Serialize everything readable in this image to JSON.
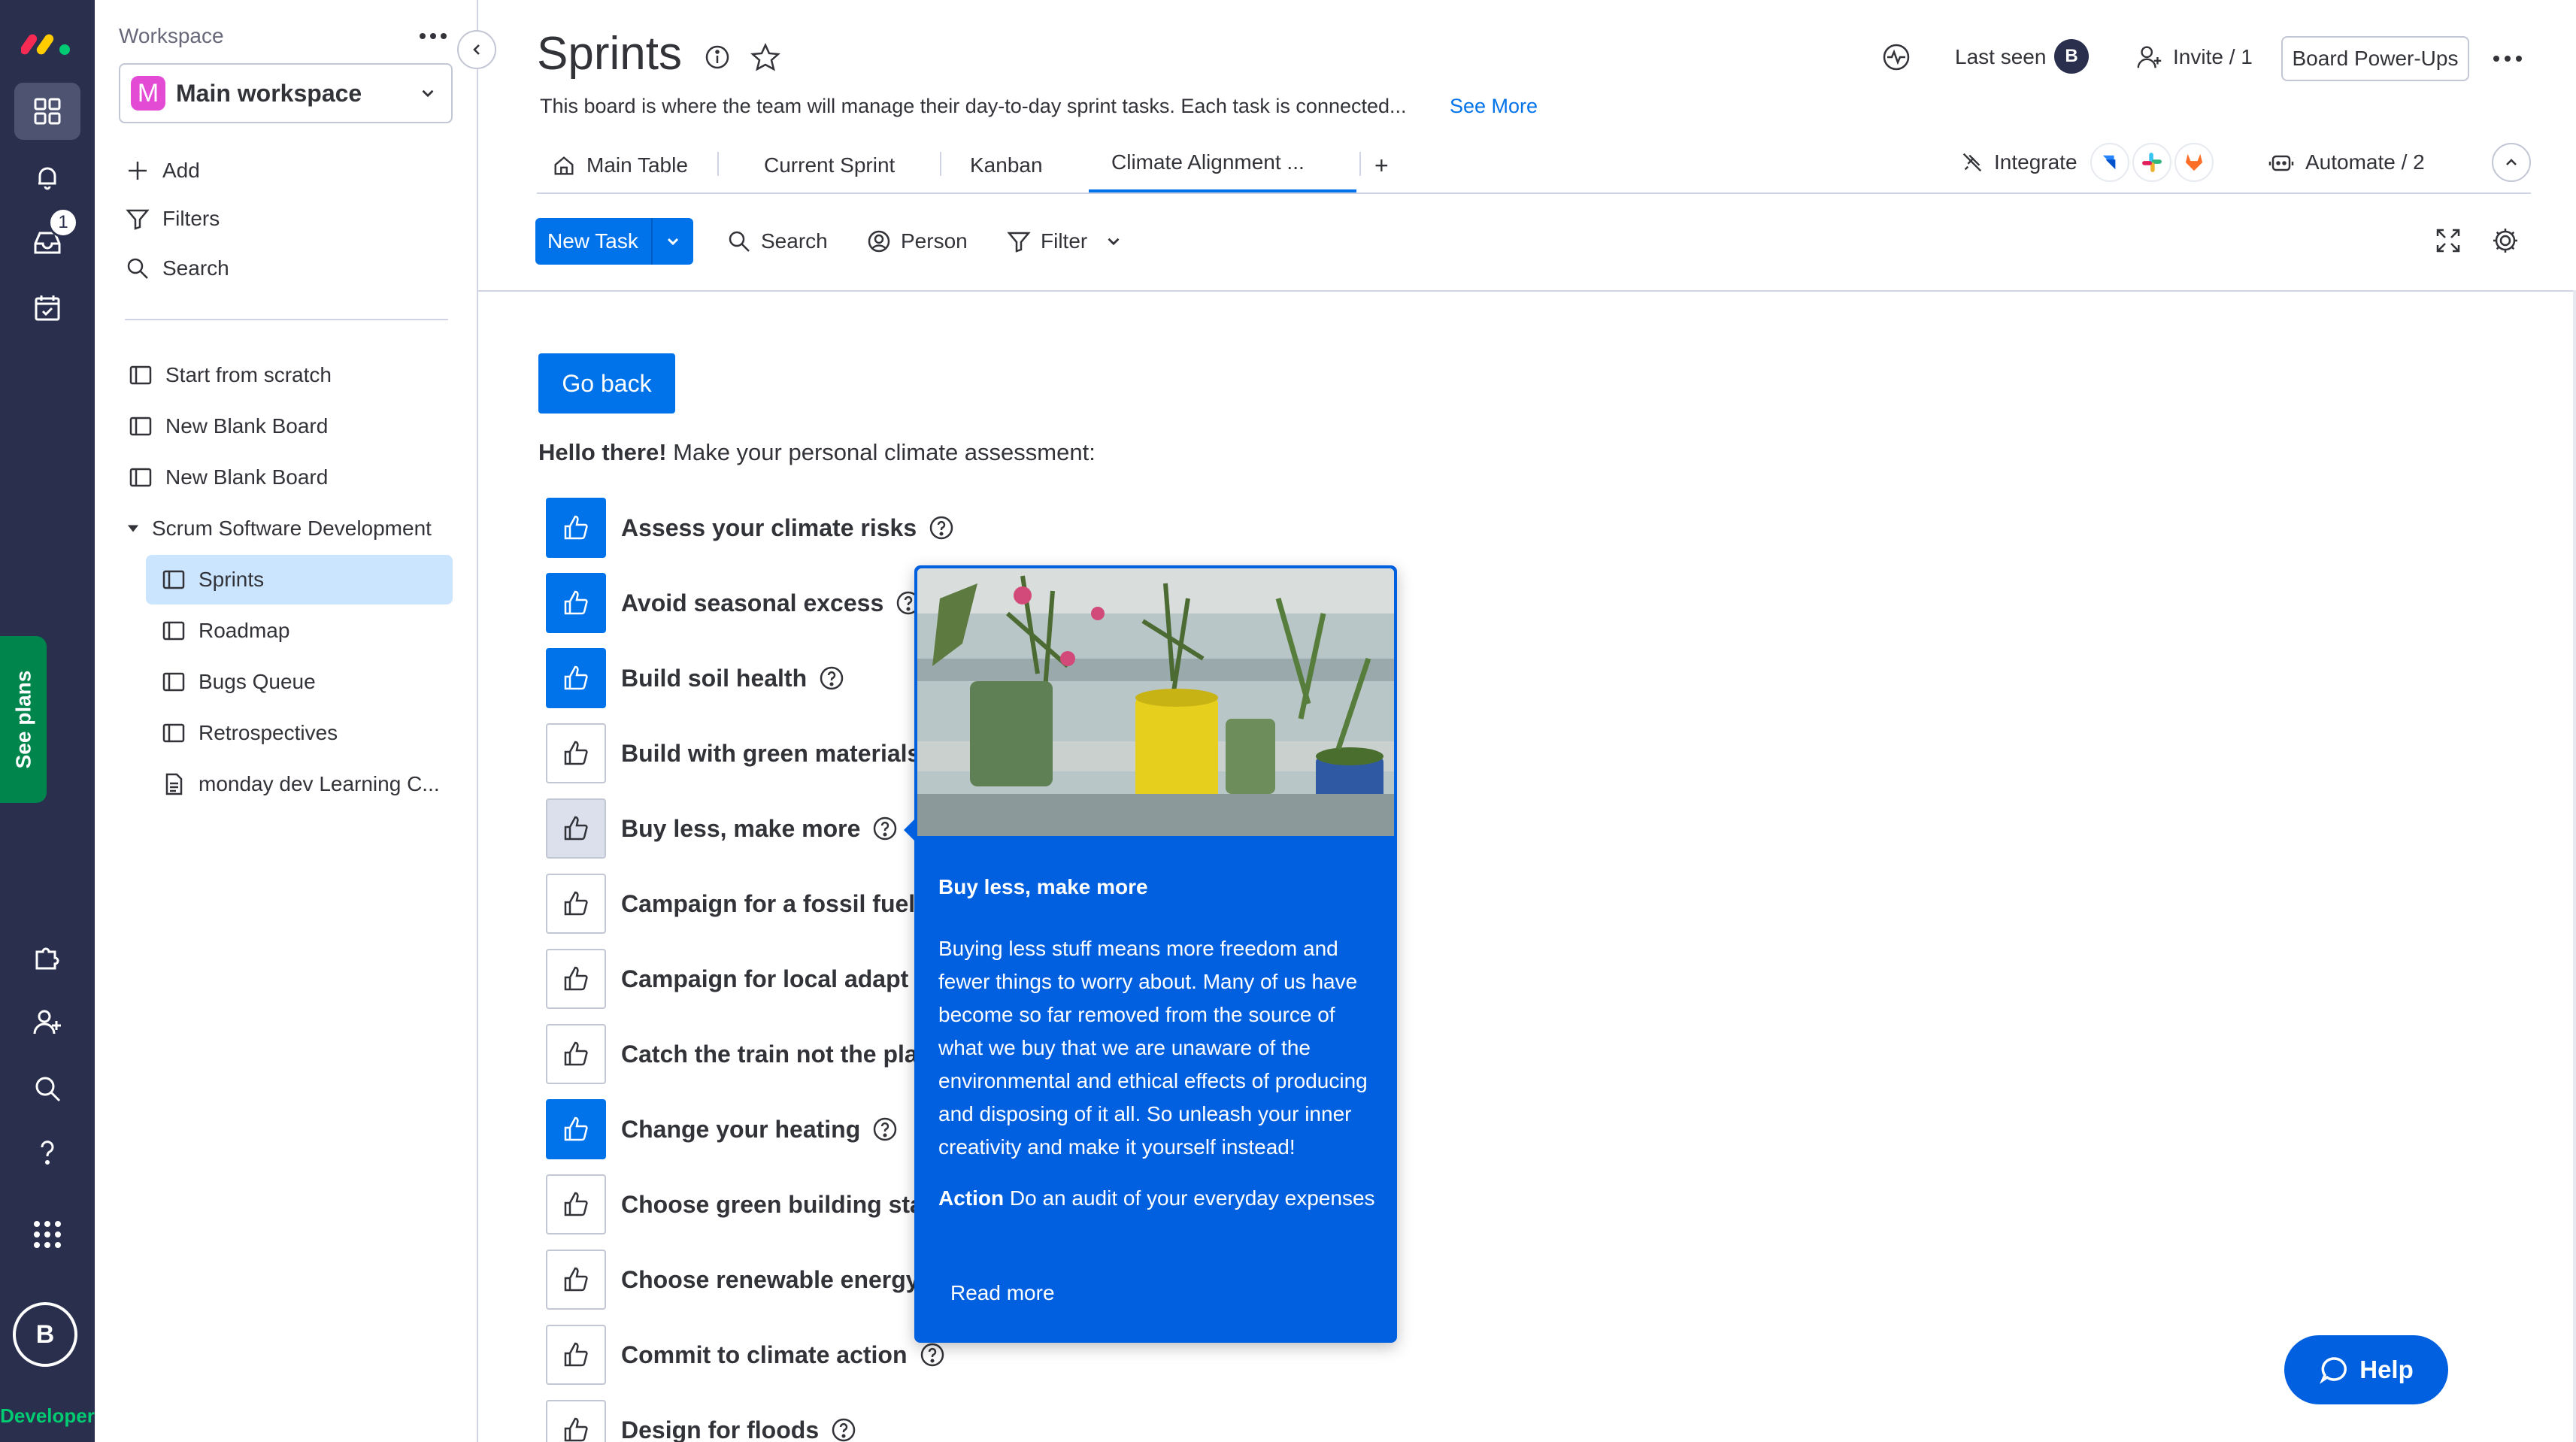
{
  "rail": {
    "notification_count": "1",
    "avatar_initial": "B",
    "developer_label": "Developer",
    "see_plans_label": "See plans"
  },
  "sidebar": {
    "workspace_label": "Workspace",
    "workspace_initial": "M",
    "workspace_name": "Main workspace",
    "actions": [
      {
        "label": "Add"
      },
      {
        "label": "Filters"
      },
      {
        "label": "Search"
      }
    ],
    "boards": [
      {
        "label": "Start from scratch"
      },
      {
        "label": "New Blank Board"
      },
      {
        "label": "New Blank Board"
      }
    ],
    "folder": {
      "label": "Scrum Software Development",
      "items": [
        {
          "label": "Sprints"
        },
        {
          "label": "Roadmap"
        },
        {
          "label": "Bugs Queue"
        },
        {
          "label": "Retrospectives"
        },
        {
          "label": "monday dev Learning C..."
        }
      ]
    }
  },
  "header": {
    "title": "Sprints",
    "description": "This board is where the team will manage their day-to-day sprint tasks. Each task is connected...",
    "see_more": "See More",
    "last_seen": "Last seen",
    "last_seen_avatar": "B",
    "invite": "Invite / 1",
    "power_ups": "Board Power-Ups"
  },
  "tabs": {
    "items": [
      {
        "label": "Main Table"
      },
      {
        "label": "Current Sprint"
      },
      {
        "label": "Kanban"
      },
      {
        "label": "Climate Alignment ..."
      }
    ],
    "add_label": "+",
    "integrate": "Integrate",
    "automate": "Automate / 2"
  },
  "toolbar": {
    "new_task": "New Task",
    "search": "Search",
    "person": "Person",
    "filter": "Filter"
  },
  "content": {
    "go_back": "Go back",
    "hello_bold": "Hello there!",
    "hello_rest": " Make your personal climate assessment:",
    "actions": [
      {
        "label": "Assess your climate risks"
      },
      {
        "label": "Avoid seasonal excess"
      },
      {
        "label": "Build soil health"
      },
      {
        "label": "Build with green materials"
      },
      {
        "label": "Buy less, make more"
      },
      {
        "label": "Campaign for a fossil fuel"
      },
      {
        "label": "Campaign for local adapt"
      },
      {
        "label": "Catch the train not the pla"
      },
      {
        "label": "Change your heating"
      },
      {
        "label": "Choose green building sta"
      },
      {
        "label": "Choose renewable energy"
      },
      {
        "label": "Commit to climate action"
      },
      {
        "label": "Design for floods"
      }
    ]
  },
  "popup": {
    "title": "Buy less, make more",
    "body": "Buying less stuff means more freedom and fewer things to worry about. Many of us have become so far removed from the source of what we buy that we are unaware of the environmental and ethical effects of producing and disposing of it all. So unleash your inner creativity and make it yourself instead!",
    "action_label": "Action",
    "action_text": " Do an audit of your everyday expenses",
    "read_more": "Read more"
  },
  "help": {
    "label": "Help"
  },
  "colors": {
    "primary": "#0073ea",
    "popup": "#0060df",
    "rail": "#292f4c",
    "selected": "#cce5ff",
    "see_plans": "#00854d"
  }
}
